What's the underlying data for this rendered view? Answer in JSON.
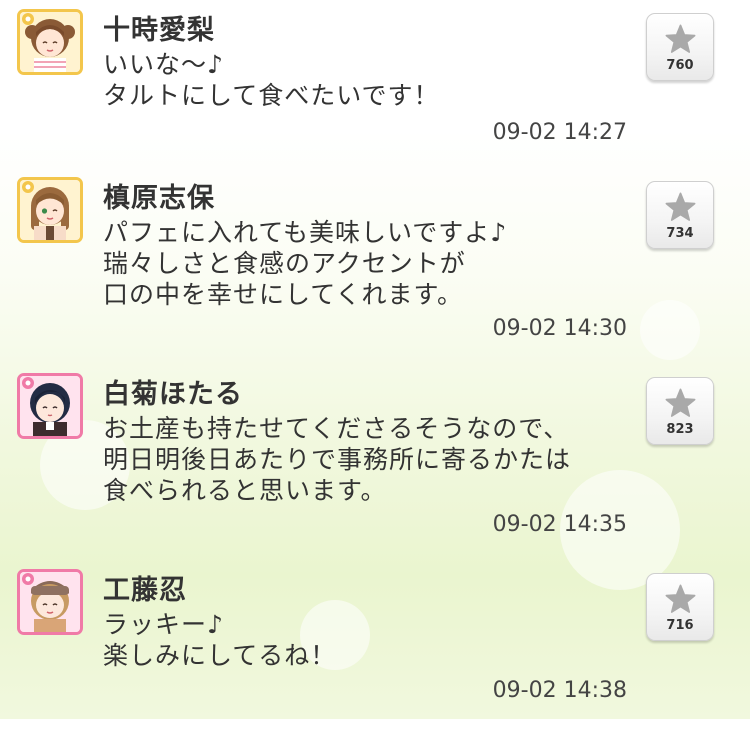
{
  "posts": [
    {
      "author": "十時愛梨",
      "lines": [
        "いいな〜♪",
        "タルトにして食べたいです！"
      ],
      "timestamp": "09-02 14:27",
      "likes": "760",
      "avatar_frame": "yellow"
    },
    {
      "author": "槙原志保",
      "lines": [
        "パフェに入れても美味しいですよ♪",
        "瑞々しさと食感のアクセントが",
        "口の中を幸せにしてくれます。"
      ],
      "timestamp": "09-02 14:30",
      "likes": "734",
      "avatar_frame": "yellow"
    },
    {
      "author": "白菊ほたる",
      "lines": [
        "お土産も持たせてくださるそうなので、",
        "明日明後日あたりで事務所に寄るかたは",
        "食べられると思います。"
      ],
      "timestamp": "09-02 14:35",
      "likes": "823",
      "avatar_frame": "pink"
    },
    {
      "author": "工藤忍",
      "lines": [
        "ラッキー♪",
        "楽しみにしてるね！"
      ],
      "timestamp": "09-02 14:38",
      "likes": "716",
      "avatar_frame": "pink"
    }
  ],
  "icons": {
    "like": "star-icon",
    "frame_badge": "flower-icon"
  },
  "colors": {
    "text": "#333333",
    "frame_yellow": "#f3c64c",
    "frame_pink": "#f07aa7",
    "star": "#a9a9a9"
  }
}
